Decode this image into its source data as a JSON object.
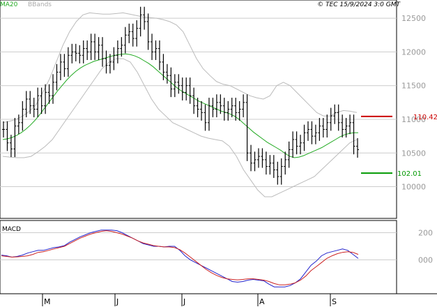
{
  "header": {
    "legend": [
      {
        "label": "MA20",
        "color": "#22aa22"
      },
      {
        "label": "BBands",
        "color": "#aaaaaa"
      }
    ],
    "copyright": "© TEC 15/9/2024 3:0 GMT"
  },
  "colors": {
    "ma": "#22aa22",
    "bbands": "#bbbbbb",
    "macd_line": "#2222cc",
    "signal_line": "#cc2222",
    "resistance": "#cc0000",
    "support": "#009900",
    "price_bar": "#000000",
    "grid": "#cccccc"
  },
  "chart_data": [
    {
      "type": "ohlc",
      "x_months": [
        "M",
        "J",
        "J",
        "A",
        "S"
      ],
      "y_ticks": [
        "12500",
        "12000",
        "11500",
        "11000",
        "10500",
        "10000"
      ],
      "ylim": [
        9550,
        12750
      ],
      "series": {
        "close": [
          10850,
          10650,
          10560,
          10900,
          10950,
          11150,
          11300,
          11200,
          11150,
          11350,
          11200,
          11400,
          11350,
          11550,
          11700,
          11850,
          11750,
          11950,
          12000,
          11980,
          11950,
          12050,
          12000,
          12150,
          12000,
          12100,
          11900,
          11800,
          11850,
          11950,
          12050,
          12100,
          12250,
          12300,
          12200,
          12350,
          12550,
          12450,
          12150,
          12000,
          12050,
          11850,
          11700,
          11650,
          11450,
          11550,
          11500,
          11400,
          11500,
          11350,
          11200,
          11150,
          11100,
          10950,
          11200,
          11150,
          11250,
          11200,
          11100,
          11150,
          11200,
          11100,
          11150,
          11250,
          10500,
          10350,
          10400,
          10450,
          10400,
          10300,
          10350,
          10250,
          10150,
          10300,
          10400,
          10550,
          10700,
          10600,
          10650,
          10800,
          10850,
          10750,
          10800,
          10900,
          10850,
          10950,
          11050,
          11100,
          10950,
          10850,
          10900,
          10950,
          10600,
          10550
        ],
        "ma20": [
          10700,
          10710,
          10730,
          10760,
          10800,
          10850,
          10910,
          10980,
          11060,
          11150,
          11240,
          11330,
          11420,
          11500,
          11580,
          11650,
          11710,
          11760,
          11800,
          11830,
          11860,
          11880,
          11900,
          11920,
          11940,
          11955,
          11965,
          11970,
          11960,
          11940,
          11910,
          11870,
          11830,
          11780,
          11720,
          11660,
          11600,
          11540,
          11480,
          11430,
          11390,
          11350,
          11310,
          11270,
          11240,
          11210,
          11180,
          11150,
          11120,
          11100,
          11075,
          11040,
          10990,
          10930,
          10870,
          10810,
          10760,
          10710,
          10660,
          10620,
          10580,
          10540,
          10490,
          10450,
          10430,
          10440,
          10460,
          10490,
          10520,
          10550,
          10580,
          10620,
          10660,
          10700,
          10740,
          10770,
          10790,
          10800,
          10800
        ],
        "bb_upper": [
          10950,
          10970,
          11000,
          11050,
          11120,
          11220,
          11400,
          11600,
          11850,
          12100,
          12300,
          12450,
          12550,
          12580,
          12570,
          12560,
          12560,
          12570,
          12580,
          12560,
          12540,
          12520,
          12510,
          12500,
          12480,
          12450,
          12400,
          12300,
          12100,
          11900,
          11750,
          11650,
          11560,
          11520,
          11500,
          11450,
          11400,
          11350,
          11320,
          11300,
          11350,
          11500,
          11550,
          11500,
          11400,
          11300,
          11200,
          11100,
          11050,
          11050,
          11100,
          11130,
          11120,
          11100
        ],
        "bb_lower": [
          10450,
          10440,
          10430,
          10430,
          10450,
          10520,
          10600,
          10700,
          10850,
          11000,
          11150,
          11300,
          11450,
          11600,
          11750,
          11850,
          11900,
          11900,
          11850,
          11700,
          11500,
          11300,
          11150,
          11050,
          10950,
          10900,
          10850,
          10800,
          10750,
          10720,
          10700,
          10680,
          10600,
          10450,
          10250,
          10100,
          9950,
          9850,
          9850,
          9900,
          9950,
          10000,
          10050,
          10100,
          10150,
          10250,
          10350,
          10450,
          10550,
          10650,
          10700
        ]
      },
      "levels": [
        {
          "value": 11042,
          "label": "110.42",
          "kind": "resistance"
        },
        {
          "value": 10201,
          "label": "102.01",
          "kind": "support"
        }
      ]
    },
    {
      "type": "line",
      "title": "MACD",
      "y_ticks": [
        "200",
        "000"
      ],
      "ylim": [
        -240,
        280
      ],
      "series": [
        {
          "values": [
            35,
            30,
            20,
            25,
            35,
            50,
            60,
            70,
            70,
            80,
            90,
            95,
            105,
            130,
            150,
            170,
            185,
            200,
            210,
            220,
            220,
            220,
            215,
            200,
            180,
            160,
            140,
            120,
            110,
            100,
            100,
            95,
            100,
            100,
            70,
            30,
            0,
            -20,
            -40,
            -60,
            -80,
            -100,
            -120,
            -140,
            -160,
            -165,
            -160,
            -150,
            -145,
            -150,
            -155,
            -180,
            -200,
            -200,
            -200,
            -190,
            -170,
            -140,
            -90,
            -40,
            -10,
            30,
            50,
            60,
            70,
            80,
            70,
            40,
            10
          ]
        },
        {
          "values": [
            30,
            25,
            20,
            22,
            25,
            30,
            40,
            55,
            60,
            70,
            80,
            90,
            100,
            120,
            140,
            160,
            175,
            190,
            200,
            210,
            215,
            210,
            200,
            190,
            175,
            160,
            140,
            125,
            115,
            105,
            100,
            95,
            95,
            90,
            75,
            50,
            20,
            -10,
            -40,
            -70,
            -95,
            -115,
            -130,
            -140,
            -145,
            -148,
            -145,
            -140,
            -140,
            -145,
            -150,
            -160,
            -175,
            -185,
            -185,
            -180,
            -170,
            -150,
            -120,
            -80,
            -50,
            -20,
            10,
            30,
            45,
            55,
            60,
            55,
            40
          ]
        }
      ]
    }
  ]
}
